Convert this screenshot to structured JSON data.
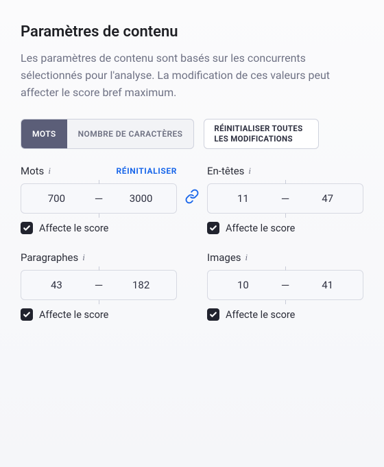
{
  "title": "Paramètres de contenu",
  "description": "Les paramètres de contenu sont basés sur les concurrents sélectionnés pour l'analyse. La modification de ces valeurs peut affecter le score bref maximum.",
  "tabs": {
    "words": "MOTS",
    "chars": "NOMBRE DE CARACTÈRES"
  },
  "reset_all": "RÉINITIALISER TOUTES LES MODIFICATIONS",
  "reset_one": "RÉINITIALISER",
  "affects_label": "Affecte le score",
  "fields": {
    "words": {
      "label": "Mots",
      "min": "700",
      "max": "3000",
      "show_reset": true
    },
    "headers": {
      "label": "En-têtes",
      "min": "11",
      "max": "47"
    },
    "paragraphs": {
      "label": "Paragraphes",
      "min": "43",
      "max": "182"
    },
    "images": {
      "label": "Images",
      "min": "10",
      "max": "41"
    }
  },
  "range_separator": "—"
}
